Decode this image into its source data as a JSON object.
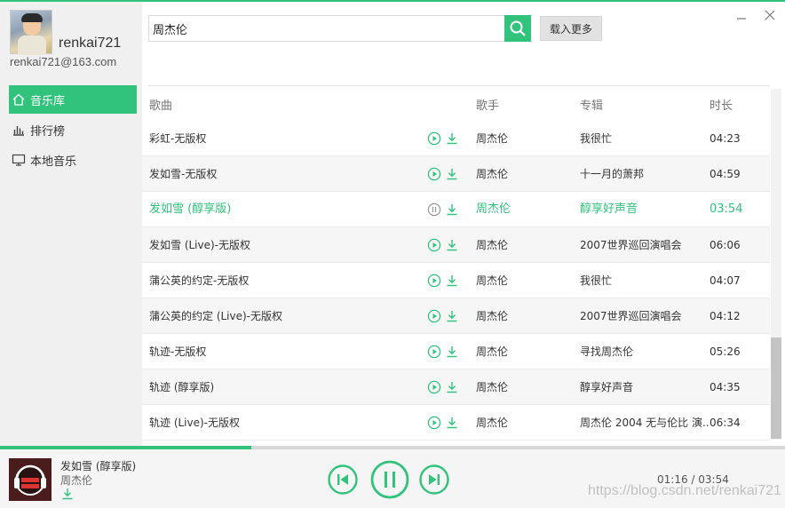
{
  "user": {
    "name": "renkai721",
    "email": "renkai721@163.com"
  },
  "nav": [
    {
      "label": "音乐库",
      "icon": "home-icon",
      "active": true
    },
    {
      "label": "排行榜",
      "icon": "chart-bars-icon",
      "active": false
    },
    {
      "label": "本地音乐",
      "icon": "monitor-icon",
      "active": false
    }
  ],
  "search": {
    "value": "周杰伦",
    "more_label": "载入更多"
  },
  "columns": {
    "song": "歌曲",
    "artist": "歌手",
    "album": "专辑",
    "duration": "时长"
  },
  "songs": [
    {
      "title": "彩虹-无版权",
      "artist": "周杰伦",
      "album": "我很忙",
      "duration": "04:23",
      "state": "play"
    },
    {
      "title": "发如雪-无版权",
      "artist": "周杰伦",
      "album": "十一月的萧邦",
      "duration": "04:59",
      "state": "play"
    },
    {
      "title": "发如雪 (醇享版)",
      "artist": "周杰伦",
      "album": "醇享好声音",
      "duration": "03:54",
      "state": "pause"
    },
    {
      "title": "发如雪 (Live)-无版权",
      "artist": "周杰伦",
      "album": "2007世界巡回演唱会",
      "duration": "06:06",
      "state": "play"
    },
    {
      "title": "蒲公英的约定-无版权",
      "artist": "周杰伦",
      "album": "我很忙",
      "duration": "04:07",
      "state": "play"
    },
    {
      "title": "蒲公英的约定 (Live)-无版权",
      "artist": "周杰伦",
      "album": "2007世界巡回演唱会",
      "duration": "04:12",
      "state": "play"
    },
    {
      "title": "轨迹-无版权",
      "artist": "周杰伦",
      "album": "寻找周杰伦",
      "duration": "05:26",
      "state": "play"
    },
    {
      "title": "轨迹 (醇享版)",
      "artist": "周杰伦",
      "album": "醇享好声音",
      "duration": "04:35",
      "state": "play"
    },
    {
      "title": "轨迹 (Live)-无版权",
      "artist": "周杰伦",
      "album": "周杰伦 2004 无与伦比 演...",
      "duration": "06:34",
      "state": "play"
    }
  ],
  "now_playing": {
    "title": "发如雪 (醇享版)",
    "artist": "周杰伦",
    "time_display": "01:16 / 03:54",
    "progress_fraction": 0.32
  },
  "watermark": "https://blog.csdn.net/renkai721",
  "colors": {
    "accent": "#31c27c",
    "sidebar_bg": "#f0f0f0",
    "player_bg": "#f5f5f5"
  }
}
